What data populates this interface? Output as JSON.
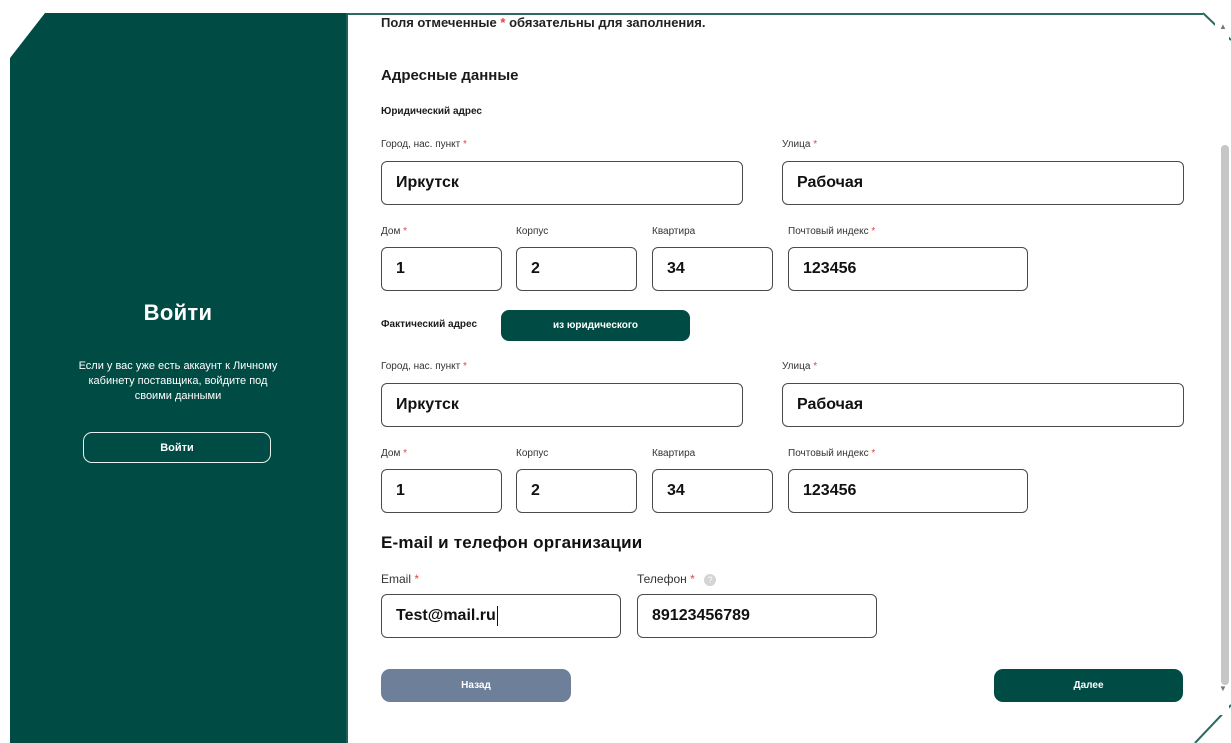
{
  "left_panel": {
    "title": "Войти",
    "text": "Если у вас уже есть аккаунт к Личному кабинету поставщика, войдите под своими данными",
    "login_button": "Войти"
  },
  "form": {
    "required_note_prefix": "Поля отмеченные",
    "required_note_star": "*",
    "required_note_suffix": "обязательны для заполнения.",
    "address_section_title": "Адресные данные",
    "legal": {
      "title": "Юридический адрес",
      "city_label": "Город, нас. пункт",
      "city_value": "Иркутск",
      "street_label": "Улица",
      "street_value": "Рабочая",
      "house_label": "Дом",
      "house_value": "1",
      "building_label": "Корпус",
      "building_value": "2",
      "apartment_label": "Квартира",
      "apartment_value": "34",
      "postal_label": "Почтовый индекс",
      "postal_value": "123456"
    },
    "actual": {
      "title": "Фактический адрес",
      "copy_button": "из юридического",
      "city_label": "Город, нас. пункт",
      "city_value": "Иркутск",
      "street_label": "Улица",
      "street_value": "Рабочая",
      "house_label": "Дом",
      "house_value": "1",
      "building_label": "Корпус",
      "building_value": "2",
      "apartment_label": "Квартира",
      "apartment_value": "34",
      "postal_label": "Почтовый индекс",
      "postal_value": "123456"
    },
    "contacts": {
      "title": "E-mail и телефон организации",
      "email_label": "Email",
      "email_value": "Test@mail.ru",
      "phone_label": "Телефон",
      "phone_value": "89123456789",
      "help_icon": "?"
    },
    "star": "*",
    "back_button": "Назад",
    "next_button": "Далее"
  },
  "colors": {
    "brand": "#004b44",
    "back_button": "#6e7f99",
    "required": "#e04646"
  }
}
